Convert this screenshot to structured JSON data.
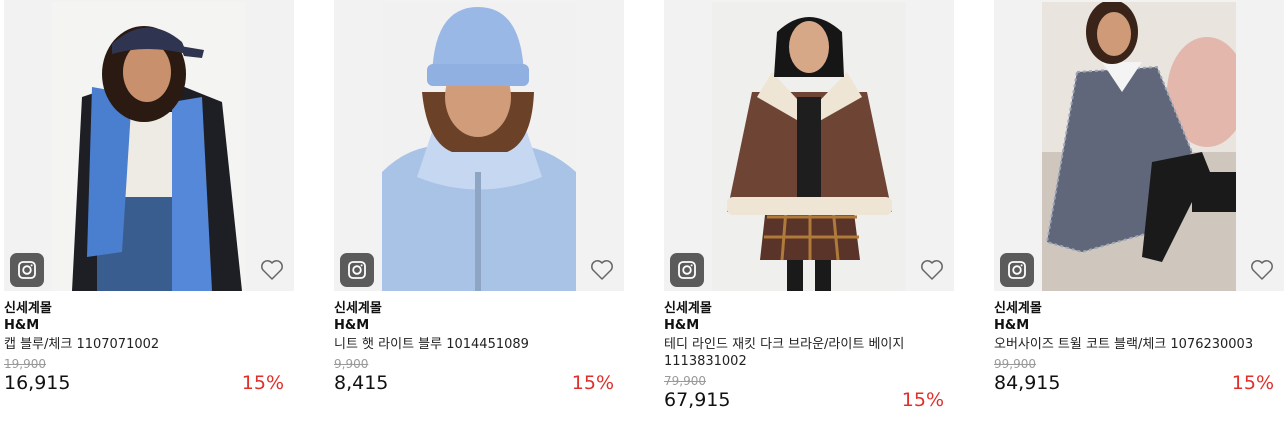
{
  "products": [
    {
      "seller": "신세계몰",
      "brand": "H&M",
      "name": "캡 블루/체크 1107071002",
      "original_price": "19,900",
      "price": "16,915",
      "discount": "15%",
      "brand_icon": "instagram-icon",
      "wishlist_icon": "heart-outline-icon"
    },
    {
      "seller": "신세계몰",
      "brand": "H&M",
      "name": "니트 햇 라이트 블루 1014451089",
      "original_price": "9,900",
      "price": "8,415",
      "discount": "15%",
      "brand_icon": "instagram-icon",
      "wishlist_icon": "heart-outline-icon"
    },
    {
      "seller": "신세계몰",
      "brand": "H&M",
      "name": "테디 라인드 재킷 다크 브라운/라이트 베이지 1113831002",
      "original_price": "79,900",
      "price": "67,915",
      "discount": "15%",
      "brand_icon": "instagram-icon",
      "wishlist_icon": "heart-outline-icon"
    },
    {
      "seller": "신세계몰",
      "brand": "H&M",
      "name": "오버사이즈 트윌 코트 블랙/체크 1076230003",
      "original_price": "99,900",
      "price": "84,915",
      "discount": "15%",
      "brand_icon": "instagram-icon",
      "wishlist_icon": "heart-outline-icon"
    }
  ],
  "colors": {
    "discount": "#e0302b",
    "strike_price": "#9a9a9a",
    "thumb_bg": "#f2f2f2",
    "chip_bg": "#5b5b5b"
  }
}
